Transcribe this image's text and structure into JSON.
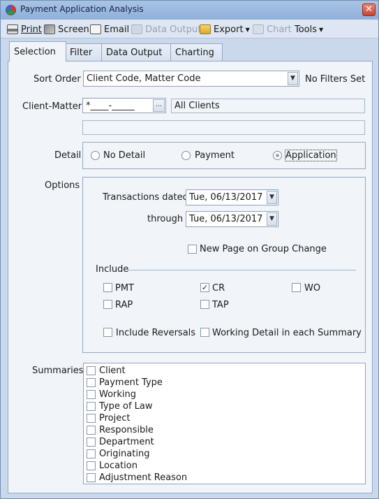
{
  "window": {
    "title": "Payment Application Analysis",
    "close_glyph": "✕"
  },
  "toolbar": {
    "print": "Print",
    "screen": "Screen",
    "email": "Email",
    "data_output": "Data Output",
    "export": "Export",
    "chart": "Chart",
    "tools": "Tools"
  },
  "tabs": [
    "Selection",
    "Filter",
    "Data Output",
    "Charting"
  ],
  "selection": {
    "sort_order_label": "Sort Order",
    "sort_order_value": "Client Code, Matter Code",
    "filters_status": "No Filters Set",
    "client_matter_label": "Client-Matter",
    "client_matter_value": "*____-_____",
    "client_display": "All Clients",
    "client_display_2": "",
    "detail_label": "Detail",
    "detail_options": [
      "No Detail",
      "Payment",
      "Application"
    ],
    "detail_selected": "Application",
    "options_label": "Options",
    "transactions_dated_label": "Transactions dated",
    "transactions_dated_value": "Tue, 06/13/2017",
    "through_label": "through",
    "through_value": "Tue, 06/13/2017",
    "new_page_label": "New Page on Group Change",
    "include_label": "Include",
    "include_items": [
      {
        "label": "PMT",
        "checked": false
      },
      {
        "label": "CR",
        "checked": true
      },
      {
        "label": "WO",
        "checked": false
      },
      {
        "label": "RAP",
        "checked": false
      },
      {
        "label": "TAP",
        "checked": false
      }
    ],
    "include_reversals_label": "Include Reversals",
    "working_detail_label": "Working Detail in each Summary",
    "summaries_label": "Summaries",
    "summaries": [
      "Client",
      "Payment Type",
      "Working",
      "Type of Law",
      "Project",
      "Responsible",
      "Department",
      "Originating",
      "Location",
      "Adjustment Reason"
    ]
  }
}
